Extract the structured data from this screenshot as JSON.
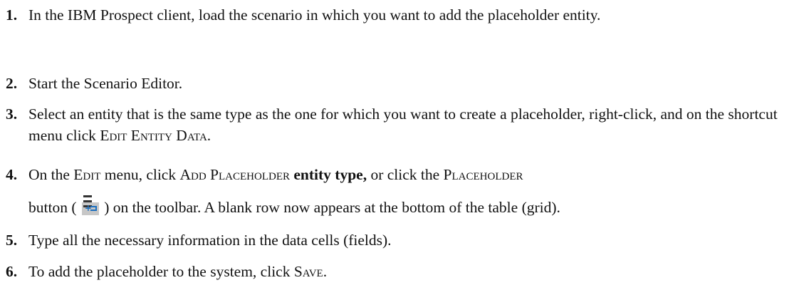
{
  "steps": [
    {
      "number": "1.",
      "text": "In the IBM Prospect client, load the scenario in which you want to add the placeholder entity."
    },
    {
      "number": "2.",
      "text": "Start the Scenario Editor."
    },
    {
      "number": "3.",
      "text_before": "Select an entity that is the same type as the one for which you want to create a placeholder, right-click, and on the shortcut menu click ",
      "command": "Edit Entity Data",
      "text_after": "."
    },
    {
      "number": "4.",
      "text_before": "On the ",
      "menu": "Edit",
      "text_mid1": " menu, click ",
      "command": "Add Placeholder",
      "bold_text": " entity type,",
      "text_mid2": " or click the ",
      "button_name": "Placeholder",
      "text_button_open": "button (",
      "icon": "add-placeholder-icon",
      "text_after": ") on the toolbar. A blank row now appears at the bottom of the table (grid)."
    },
    {
      "number": "5.",
      "text": "Type all the necessary information in the data cells (fields)."
    },
    {
      "number": "6.",
      "text_before": "To add the placeholder to the system, click ",
      "command": "Save",
      "text_after": "."
    }
  ]
}
